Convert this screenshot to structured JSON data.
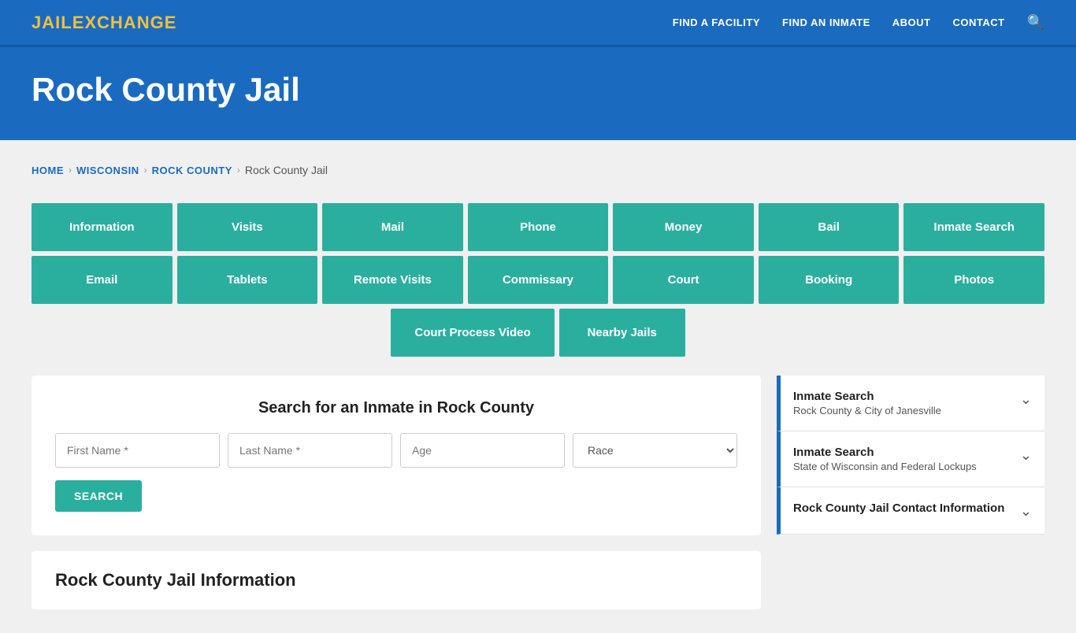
{
  "header": {
    "logo_jail": "JAIL",
    "logo_exchange": "EXCHANGE",
    "nav_items": [
      {
        "label": "FIND A FACILITY",
        "href": "#"
      },
      {
        "label": "FIND AN INMATE",
        "href": "#"
      },
      {
        "label": "ABOUT",
        "href": "#"
      },
      {
        "label": "CONTACT",
        "href": "#"
      }
    ]
  },
  "hero": {
    "title": "Rock County Jail"
  },
  "breadcrumb": {
    "home": "Home",
    "wisconsin": "Wisconsin",
    "rock_county": "Rock County",
    "current": "Rock County Jail"
  },
  "buttons_row1": [
    "Information",
    "Visits",
    "Mail",
    "Phone",
    "Money",
    "Bail",
    "Inmate Search"
  ],
  "buttons_row2": [
    "Email",
    "Tablets",
    "Remote Visits",
    "Commissary",
    "Court",
    "Booking",
    "Photos"
  ],
  "buttons_row3": [
    "Court Process Video",
    "Nearby Jails"
  ],
  "search_section": {
    "title": "Search for an Inmate in Rock County",
    "first_name_placeholder": "First Name *",
    "last_name_placeholder": "Last Name *",
    "age_placeholder": "Age",
    "race_placeholder": "Race",
    "search_button": "SEARCH"
  },
  "info_section": {
    "title": "Rock County Jail Information"
  },
  "sidebar_items": [
    {
      "title": "Inmate Search",
      "subtitle": "Rock County & City of Janesville"
    },
    {
      "title": "Inmate Search",
      "subtitle": "State of Wisconsin and Federal Lockups"
    },
    {
      "title": "Rock County Jail Contact Information",
      "subtitle": ""
    }
  ]
}
